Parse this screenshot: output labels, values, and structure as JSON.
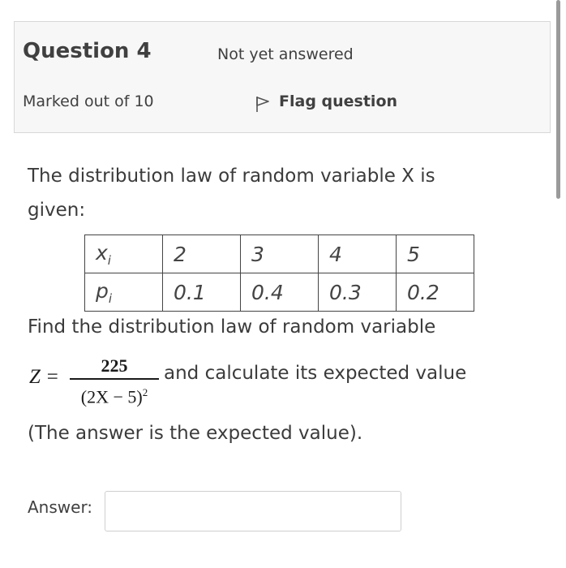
{
  "question": {
    "title": "Question 4",
    "state": "Not yet answered",
    "grade": "Marked out of 10",
    "flag_label": "Flag question",
    "flag_icon": "flag-icon"
  },
  "content": {
    "intro": "The distribution law of random variable X is given:",
    "table": {
      "row_x": {
        "label": "x",
        "sub": "i",
        "values": [
          "2",
          "3",
          "4",
          "5"
        ]
      },
      "row_p": {
        "label": "p",
        "sub": "i",
        "values": [
          "0.1",
          "0.4",
          "0.3",
          "0.2"
        ]
      }
    },
    "find_text": "Find the distribution law of random variable",
    "formula": {
      "lhs": "Z =",
      "numerator": "225",
      "denominator": "(2X − 5)",
      "exponent": "2"
    },
    "formula_tail": "and calculate its expected value",
    "note": "(The answer is the expected value)."
  },
  "answer": {
    "label": "Answer:",
    "value": "",
    "placeholder": ""
  },
  "colors": {
    "info_bg": "#f7f7f7",
    "info_border": "#d8d8d8",
    "text": "#3b3b3b"
  }
}
